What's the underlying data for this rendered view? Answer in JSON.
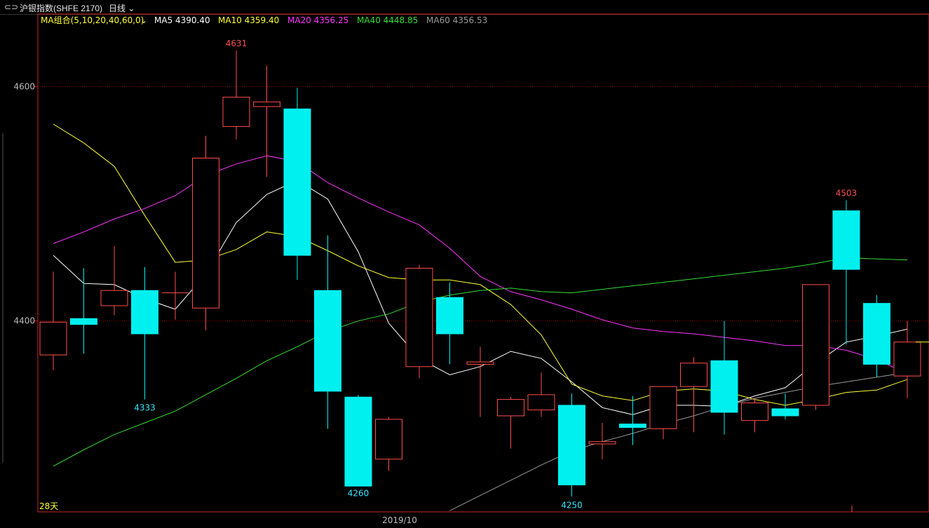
{
  "header": {
    "link_icon": "link-icon",
    "instrument": "沪银指数(SHFE 2170)",
    "period": "日线",
    "ma_combo": "MA组合(5,10,20,40,60,0)",
    "ma_values": [
      {
        "label": "MA5 4390.40",
        "color": "#ffffff"
      },
      {
        "label": "MA10 4359.40",
        "color": "#ffff33"
      },
      {
        "label": "MA20 4356.25",
        "color": "#ff33ff"
      },
      {
        "label": "MA40 4448.85",
        "color": "#33dd33"
      },
      {
        "label": "MA60 4356.53",
        "color": "#999999"
      }
    ]
  },
  "chart_data": {
    "type": "candlestick",
    "y_ticks": [
      4600,
      4400
    ],
    "ylim": [
      4237,
      4662
    ],
    "x_label": "2019/10",
    "corner_label": "28天",
    "colors": {
      "up": "#ff4d4d",
      "down": "#00f0f0",
      "frame": "#cc2222",
      "grid": "#990000"
    },
    "candles": [
      {
        "o": 4371,
        "h": 4442,
        "l": 4358,
        "c": 4399
      },
      {
        "o": 4402,
        "h": 4445,
        "l": 4372,
        "c": 4397
      },
      {
        "o": 4413,
        "h": 4464,
        "l": 4405,
        "c": 4426
      },
      {
        "o": 4426,
        "h": 4446,
        "l": 4333,
        "c": 4389
      },
      {
        "o": 4424,
        "h": 4442,
        "l": 4401,
        "c": 4424
      },
      {
        "o": 4411,
        "h": 4558,
        "l": 4392,
        "c": 4539
      },
      {
        "o": 4566,
        "h": 4631,
        "l": 4555,
        "c": 4591
      },
      {
        "o": 4583,
        "h": 4618,
        "l": 4523,
        "c": 4587
      },
      {
        "o": 4581,
        "h": 4599,
        "l": 4435,
        "c": 4456
      },
      {
        "o": 4426,
        "h": 4473,
        "l": 4308,
        "c": 4340
      },
      {
        "o": 4335,
        "h": 4337,
        "l": 4260,
        "c": 4259
      },
      {
        "o": 4282,
        "h": 4318,
        "l": 4272,
        "c": 4316
      },
      {
        "o": 4361,
        "h": 4448,
        "l": 4351,
        "c": 4445
      },
      {
        "o": 4420,
        "h": 4433,
        "l": 4363,
        "c": 4389
      },
      {
        "o": 4363,
        "h": 4378,
        "l": 4318,
        "c": 4365
      },
      {
        "o": 4319,
        "h": 4335,
        "l": 4291,
        "c": 4333
      },
      {
        "o": 4324,
        "h": 4356,
        "l": 4318,
        "c": 4337
      },
      {
        "o": 4328,
        "h": 4338,
        "l": 4250,
        "c": 4260
      },
      {
        "o": 4295,
        "h": 4313,
        "l": 4282,
        "c": 4297
      },
      {
        "o": 4312,
        "h": 4336,
        "l": 4294,
        "c": 4309
      },
      {
        "o": 4308,
        "h": 4336,
        "l": 4299,
        "c": 4344
      },
      {
        "o": 4344,
        "h": 4369,
        "l": 4305,
        "c": 4364
      },
      {
        "o": 4366,
        "h": 4400,
        "l": 4303,
        "c": 4322
      },
      {
        "o": 4315,
        "h": 4334,
        "l": 4305,
        "c": 4330
      },
      {
        "o": 4325,
        "h": 4338,
        "l": 4316,
        "c": 4319
      },
      {
        "o": 4328,
        "h": 4419,
        "l": 4324,
        "c": 4431
      },
      {
        "o": 4494,
        "h": 4503,
        "l": 4380,
        "c": 4444
      },
      {
        "o": 4415,
        "h": 4422,
        "l": 4352,
        "c": 4363
      },
      {
        "o": 4353,
        "h": 4400,
        "l": 4334,
        "c": 4382
      }
    ],
    "annotations": [
      {
        "index": 6,
        "value": 4631,
        "text": "4631",
        "color": "#ff4d4d",
        "pos": "above"
      },
      {
        "index": 3,
        "value": 4333,
        "text": "4333",
        "color": "#33e6ff",
        "pos": "below"
      },
      {
        "index": 10,
        "value": 4260,
        "text": "4260",
        "color": "#33e6ff",
        "pos": "below"
      },
      {
        "index": 17,
        "value": 4250,
        "text": "4250",
        "color": "#33e6ff",
        "pos": "below"
      },
      {
        "index": 26,
        "value": 4503,
        "text": "4503",
        "color": "#ff4d4d",
        "pos": "above"
      }
    ],
    "series": [
      {
        "name": "MA5",
        "color": "#ffffff",
        "values": [
          4456,
          4432,
          4431,
          4419,
          4410,
          4440,
          4484,
          4508,
          4520,
          4504,
          4459,
          4398,
          4368,
          4354,
          4361,
          4374,
          4368,
          4348,
          4326,
          4320,
          4328,
          4328,
          4327,
          4336,
          4343,
          4364,
          4382,
          4387,
          4393
        ]
      },
      {
        "name": "MA10",
        "color": "#ffff33",
        "values": [
          4568,
          4552,
          4532,
          4490,
          4450,
          4452,
          4461,
          4476,
          4472,
          4460,
          4447,
          4437,
          4435,
          4435,
          4431,
          4414,
          4388,
          4346,
          4336,
          4332,
          4340,
          4342,
          4340,
          4333,
          4328,
          4333,
          4339,
          4341,
          4350
        ]
      },
      {
        "name": "MA20",
        "color": "#ff33ff",
        "values": [
          4466,
          4476,
          4487,
          4496,
          4507,
          4524,
          4534,
          4541,
          4536,
          4518,
          4505,
          4493,
          4482,
          4462,
          4438,
          4425,
          4418,
          4410,
          4401,
          4394,
          4391,
          4389,
          4386,
          4383,
          4379,
          4379,
          4375,
          4367,
          4355
        ]
      },
      {
        "name": "MA40",
        "color": "#33dd33",
        "values": [
          4276,
          4290,
          4303,
          4313,
          4323,
          4337,
          4351,
          4366,
          4378,
          4391,
          4400,
          4406,
          4416,
          4422,
          4426,
          4428,
          4425,
          4424,
          4427,
          4430,
          4433,
          4436,
          4439,
          4442,
          4445,
          4449,
          4454,
          4453,
          4452
        ]
      },
      {
        "name": "MA60",
        "color": "#999999",
        "values": [
          null,
          null,
          null,
          null,
          null,
          null,
          null,
          null,
          null,
          null,
          null,
          null,
          null,
          4238,
          4251,
          4264,
          4277,
          4289,
          4297,
          4304,
          4312,
          4319,
          4327,
          4334,
          4339,
          4344,
          4348,
          4352,
          4356
        ]
      }
    ]
  }
}
